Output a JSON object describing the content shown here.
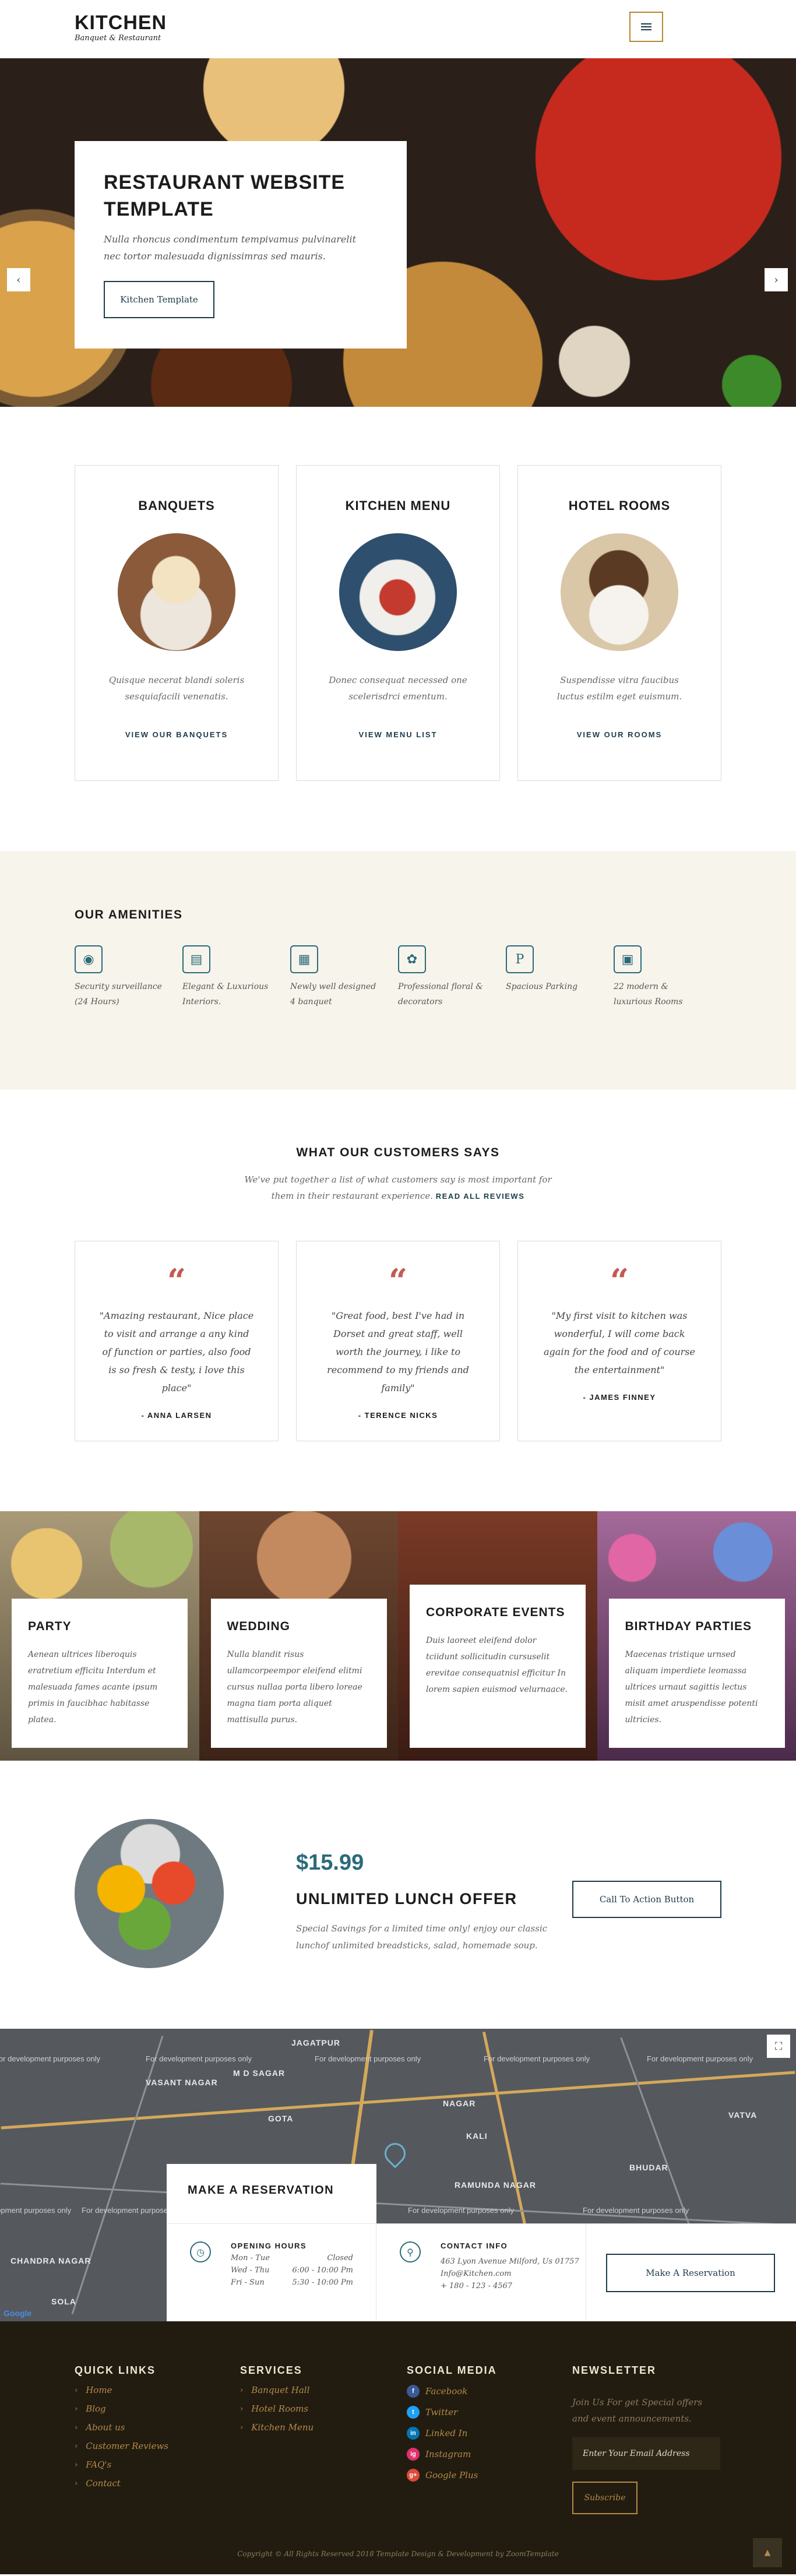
{
  "header": {
    "logo_main": "KITCHEN",
    "logo_sub": "Banquet & Restaurant",
    "menu_icon": "hamburger-icon"
  },
  "hero": {
    "title_line1": "RESTAURANT WEBSITE",
    "title_line2": "TEMPLATE",
    "text": "Nulla rhoncus condimentum tempivamus pulvinarelit nec tortor malesuada dignissimras sed mauris.",
    "button": "Kitchen Template",
    "prev_icon": "chevron-left-icon",
    "next_icon": "chevron-right-icon"
  },
  "services": [
    {
      "title": "BANQUETS",
      "text": "Quisque necerat blandi soleris sesquiafacili venenatis.",
      "link": "VIEW OUR BANQUETS"
    },
    {
      "title": "KITCHEN MENU",
      "text": "Donec consequat necessed one scelerisdrci ementum.",
      "link": "VIEW MENU LIST"
    },
    {
      "title": "HOTEL ROOMS",
      "text": "Suspendisse vitra faucibus luctus estilm eget euismum.",
      "link": "VIEW OUR ROOMS"
    }
  ],
  "amenities": {
    "title": "OUR AMENITIES",
    "items": [
      {
        "icon": "security-icon",
        "text": "Security surveillance (24 Hours)"
      },
      {
        "icon": "interior-icon",
        "text": "Elegant & Luxurious Interiors."
      },
      {
        "icon": "banquet-icon",
        "text": "Newly well designed 4 banquet"
      },
      {
        "icon": "decor-icon",
        "text": "Professional floral & decorators"
      },
      {
        "icon": "parking-icon",
        "text": "Spacious Parking"
      },
      {
        "icon": "room-icon",
        "text": "22 modern & luxurious Rooms"
      }
    ]
  },
  "testimonials": {
    "title": "WHAT OUR CUSTOMERS SAYS",
    "intro": "We've put together a list of what customers say is most important for them in their restaurant experience.",
    "link": "READ ALL REVIEWS",
    "items": [
      {
        "quote": "\"Amazing restaurant, Nice place to visit and arrange a any kind of function or parties, also food is so fresh & testy, i love this place\"",
        "author": "- ANNA LARSEN"
      },
      {
        "quote": "\"Great food, best I've had in Dorset and great staff, well worth the journey, i like to recommend to my friends and family\"",
        "author": "- TERENCE NICKS"
      },
      {
        "quote": "\"My first visit to kitchen was wonderful, I will come back again for the food and of course the entertainment\"",
        "author": "- JAMES FINNEY"
      }
    ]
  },
  "events": [
    {
      "title": "PARTY",
      "text": "Aenean ultrices liberoquis eratretium efficitu Interdum et malesuada fames acante ipsum primis in faucibhac habitasse platea."
    },
    {
      "title": "WEDDING",
      "text": "Nulla blandit risus ullamcorpeempor eleifend elitmi cursus nullaa porta libero loreae magna tiam porta aliquet mattisulla purus."
    },
    {
      "title": "CORPORATE EVENTS",
      "text": "Duis laoreet eleifend dolor tciidunt sollicitudin cursuselit erevitae consequatnisl efficitur In lorem sapien euismod velurnaace."
    },
    {
      "title": "BIRTHDAY PARTIES",
      "text": "Maecenas tristique urnsed aliquam imperdiete leomassa ultrices urnaut sagittis lectus misit amet aruspendisse potenti ultricies."
    }
  ],
  "offer": {
    "price": "$15.99",
    "title": "UNLIMITED LUNCH OFFER",
    "text": "Special Savings for a limited time only! enjoy our classic lunchof unlimited breadsticks, salad, homemade soup.",
    "button": "Call To Action Button"
  },
  "map": {
    "dev_note": "For development purposes only",
    "labels": [
      "JAGATPUR",
      "VASANT NAGAR",
      "M D SAGAR",
      "NAGAR",
      "KALI",
      "RAMUNDA NAGAR",
      "CHANDRA NAGAR",
      "SOLA",
      "GOTA",
      "BHUDAR",
      "VATVA"
    ],
    "fullscreen_icon": "fullscreen-icon",
    "google": "Google"
  },
  "reservation": {
    "title": "MAKE A RESERVATION",
    "hours_label": "OPENING HOURS",
    "hours": [
      {
        "day": "Mon - Tue",
        "time": "Closed"
      },
      {
        "day": "Wed - Thu",
        "time": "6:00 - 10:00 Pm"
      },
      {
        "day": "Fri - Sun",
        "time": "5:30 - 10:00 Pm"
      }
    ],
    "contact_label": "CONTACT INFO",
    "contact": [
      "463 Lyon Avenue Milford, Us 01757",
      "Info@Kitchen.com",
      "+ 180 - 123 - 4567"
    ],
    "button": "Make A Reservation"
  },
  "footer": {
    "quick_links_title": "QUICK LINKS",
    "quick_links": [
      "Home",
      "Blog",
      "About us",
      "Customer Reviews",
      "FAQ's",
      "Contact"
    ],
    "services_title": "SERVICES",
    "services": [
      "Banquet Hall",
      "Hotel Rooms",
      "Kitchen Menu"
    ],
    "social_title": "SOCIAL MEDIA",
    "social": [
      {
        "name": "Facebook",
        "color": "#3b5998",
        "glyph": "f"
      },
      {
        "name": "Twitter",
        "color": "#1da1f2",
        "glyph": "t"
      },
      {
        "name": "Linked In",
        "color": "#0077b5",
        "glyph": "in"
      },
      {
        "name": "Instagram",
        "color": "#e1306c",
        "glyph": "ig"
      },
      {
        "name": "Google Plus",
        "color": "#dd4b39",
        "glyph": "g+"
      }
    ],
    "newsletter_title": "NEWSLETTER",
    "newsletter_text": "Join Us For get Special offers and event announcements.",
    "newsletter_placeholder": "Enter Your Email Address",
    "subscribe": "Subscribe",
    "copyright": "Copyright © All Rights Reserved 2018 Template Design & Development by ZoomTemplate"
  }
}
